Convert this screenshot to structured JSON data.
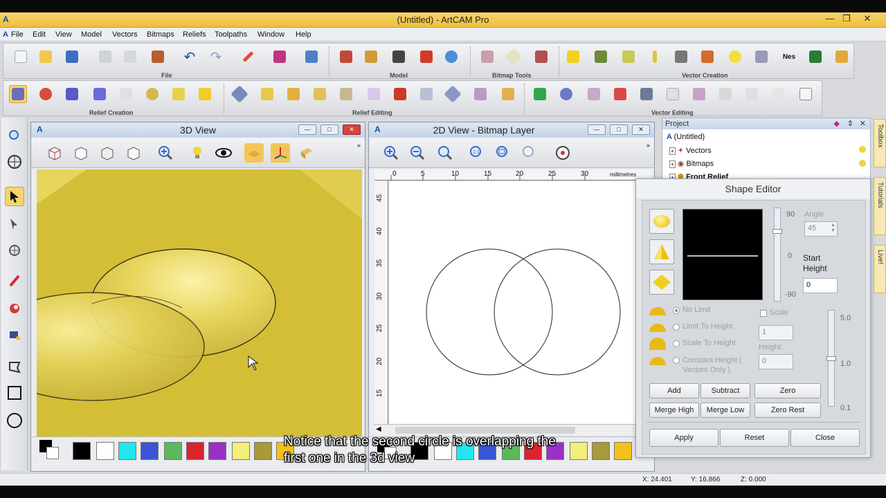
{
  "window": {
    "title": "(Untitled) - ArtCAM Pro",
    "logo": "A"
  },
  "menu": [
    "File",
    "Edit",
    "View",
    "Model",
    "Vectors",
    "Bitmaps",
    "Reliefs",
    "Toolpaths",
    "Window",
    "Help"
  ],
  "toolbar": {
    "groups1": [
      "File",
      "Model",
      "Bitmap Tools",
      "Vector Creation"
    ],
    "groups2": [
      "Relief Creation",
      "Relief Editing",
      "Vector Editing"
    ]
  },
  "view3d": {
    "title": "3D View",
    "relief_color": "#d8c23a"
  },
  "view2d": {
    "title": "2D View - Bitmap Layer",
    "unit": "millimetres",
    "hruler": [
      "0",
      "5",
      "10",
      "15",
      "20",
      "25",
      "30"
    ],
    "vruler": [
      "45",
      "40",
      "35",
      "30",
      "25",
      "20",
      "15"
    ]
  },
  "project": {
    "title": "Project",
    "items": [
      "(Untitled)",
      "Vectors",
      "Bitmaps",
      "Front Relief"
    ]
  },
  "side_tabs": [
    "Toolbox",
    "Tutorials",
    "Live!"
  ],
  "shape_editor": {
    "title": "Shape Editor",
    "angle_label": "Angle",
    "angle_value": "45",
    "slider_top": "90",
    "slider_mid": "0",
    "slider_bot": "-90",
    "start_height_label": "Start Height",
    "start_height_value": "0",
    "options": [
      "No Limit",
      "Limit To Height",
      "Scale To Height",
      "Constant Height ( Vectors Only )"
    ],
    "scale_label": "Scale",
    "scale_value": "1",
    "height_label": "Height:",
    "height_value": "0",
    "scale_ticks": [
      "5.0",
      "1.0",
      "0.1"
    ],
    "buttons_row1": [
      "Add",
      "Subtract",
      "Zero"
    ],
    "buttons_row2": [
      "Merge High",
      "Merge Low",
      "Zero Rest"
    ],
    "buttons_row3": [
      "Apply",
      "Reset",
      "Close"
    ]
  },
  "palette": [
    "#000000",
    "#ffffff",
    "#22e6ee",
    "#3b55d6",
    "#5cb85c",
    "#d9232e",
    "#9b30c8",
    "#f4ee7a",
    "#a89a3a",
    "#f2c21b"
  ],
  "caption": {
    "line1": "Notice that the second circle is overlapping the",
    "line2": "first one in the 3d view"
  },
  "status": {
    "x": "X: 24.401",
    "y": "Y: 16.866",
    "z": "Z: 0.000"
  }
}
